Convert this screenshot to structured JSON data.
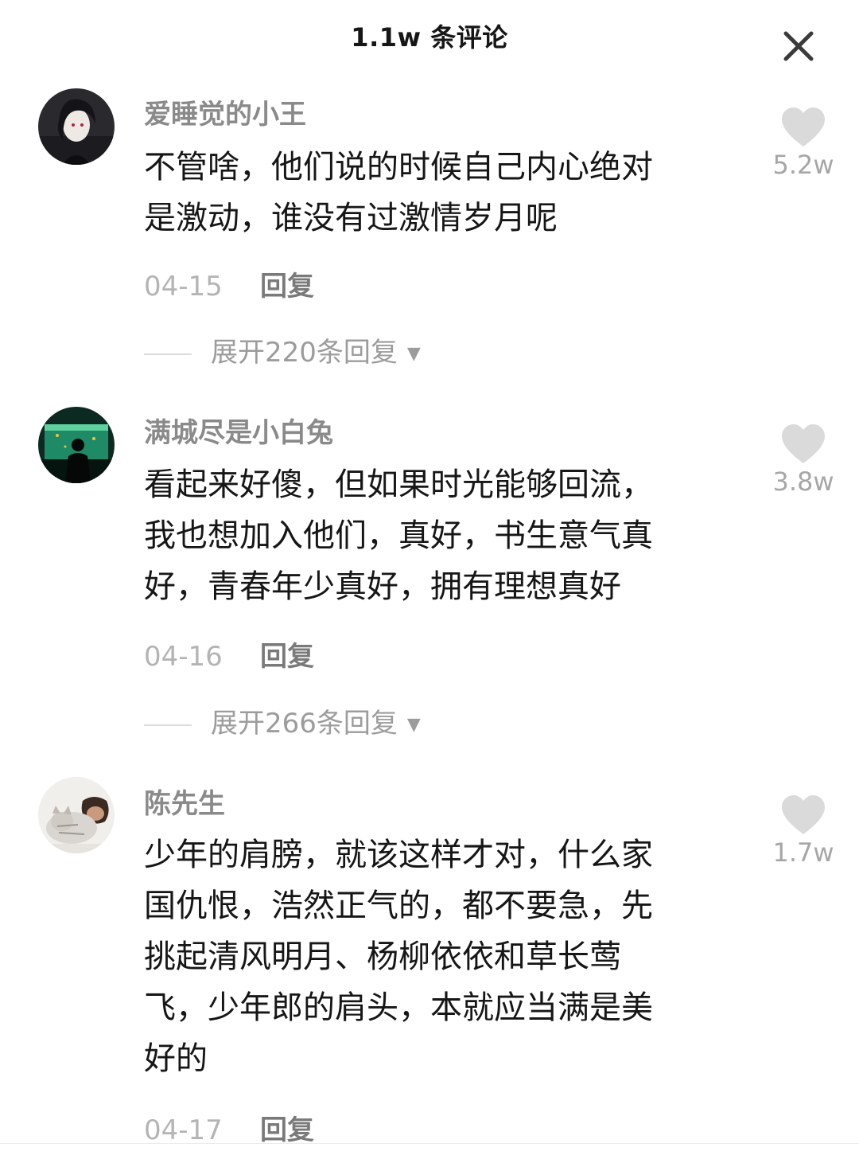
{
  "header": {
    "title": "1.1w 条评论"
  },
  "comments": [
    {
      "username": "爱睡觉的小王",
      "avatar_icon": "avatar-anime-portrait",
      "text_lines": [
        "不管啥，他们说的时候自己内心绝对",
        "是激动，谁没有过激情岁月呢"
      ],
      "date": "04-15",
      "reply_label": "回复",
      "likes": "5.2w",
      "expand_label": "展开220条回复"
    },
    {
      "username": "满城尽是小白兔",
      "avatar_icon": "avatar-aquarium-silhouette",
      "text_lines": [
        "看起来好傻，但如果时光能够回流，",
        "我也想加入他们，真好，书生意气真",
        "好，青春年少真好，拥有理想真好"
      ],
      "date": "04-16",
      "reply_label": "回复",
      "likes": "3.8w",
      "expand_label": "展开266条回复"
    },
    {
      "username": "陈先生",
      "avatar_icon": "avatar-cat-with-boy",
      "text_lines": [
        "少年的肩膀，就该这样才对，什么家",
        "国仇恨，浩然正气的，都不要急，先",
        "挑起清风明月、杨柳依依和草长莺",
        "飞，少年郎的肩头，本就应当满是美",
        "好的"
      ],
      "date": "04-17",
      "reply_label": "回复",
      "likes": "1.7w"
    }
  ],
  "colors": {
    "username": "#8a8a8a",
    "body_text": "#161616",
    "muted": "#b4b4b4",
    "heart": "#dadada"
  }
}
